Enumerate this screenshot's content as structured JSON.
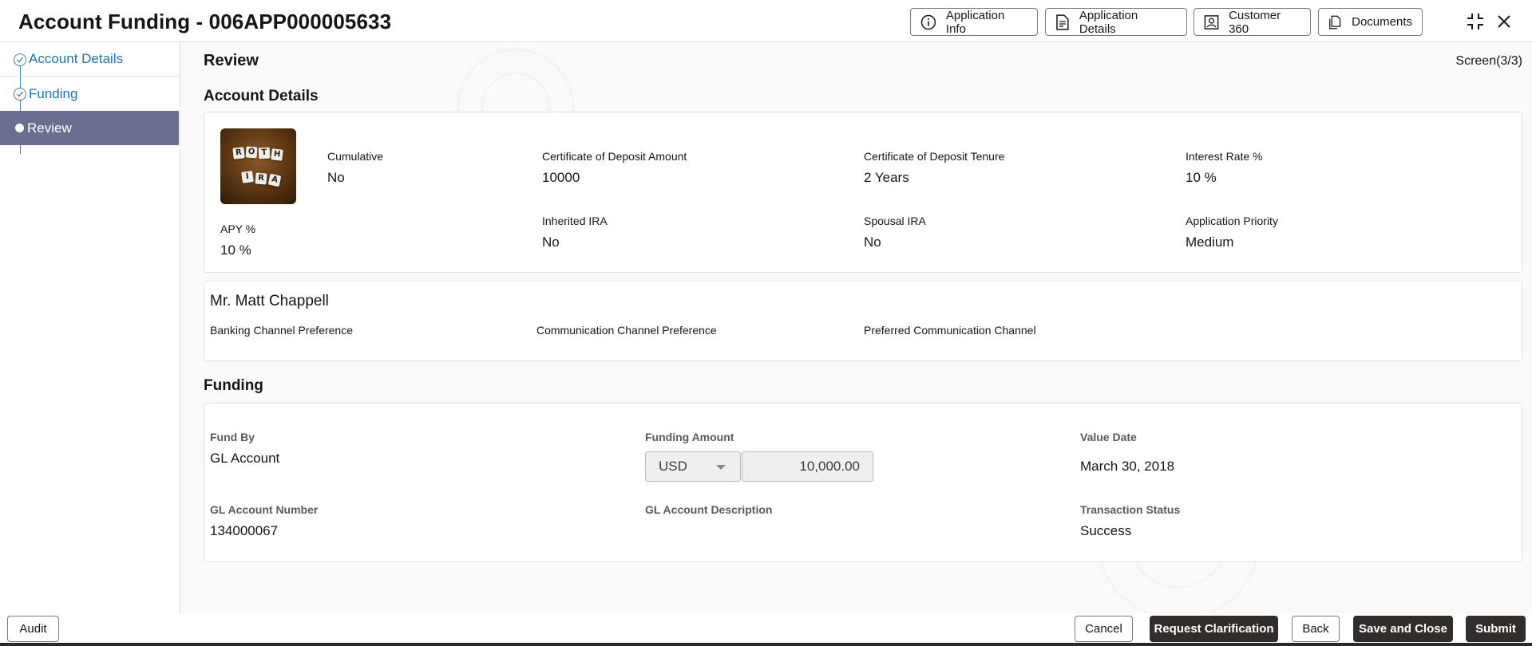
{
  "header": {
    "title": "Account Funding - 006APP000005633",
    "buttons": {
      "application_info": "Application Info",
      "application_details": "Application Details",
      "customer_360": "Customer 360",
      "documents": "Documents"
    }
  },
  "sidebar": {
    "items": [
      {
        "label": "Account Details",
        "state": "completed"
      },
      {
        "label": "Funding",
        "state": "completed"
      },
      {
        "label": "Review",
        "state": "active"
      }
    ]
  },
  "main": {
    "heading": "Review",
    "screen_indicator": "Screen(3/3)",
    "account_details": {
      "title": "Account Details",
      "image_tiles": [
        "R",
        "O",
        "T",
        "H",
        "I",
        "R",
        "A"
      ],
      "fields": {
        "cumulative": {
          "label": "Cumulative",
          "value": "No"
        },
        "cd_amount": {
          "label": "Certificate of Deposit Amount",
          "value": "10000"
        },
        "cd_tenure": {
          "label": "Certificate of Deposit Tenure",
          "value": "2 Years"
        },
        "interest_rate": {
          "label": "Interest Rate %",
          "value": "10 %"
        },
        "apy": {
          "label": "APY %",
          "value": "10 %"
        },
        "inherited_ira": {
          "label": "Inherited IRA",
          "value": "No"
        },
        "spousal_ira": {
          "label": "Spousal IRA",
          "value": "No"
        },
        "application_priority": {
          "label": "Application Priority",
          "value": "Medium"
        }
      }
    },
    "customer": {
      "name": "Mr. Matt Chappell",
      "banking_channel_label": "Banking Channel Preference",
      "communication_channel_label": "Communication Channel Preference",
      "preferred_channel_label": "Preferred Communication Channel"
    },
    "funding": {
      "title": "Funding",
      "fund_by": {
        "label": "Fund By",
        "value": "GL Account"
      },
      "funding_amount": {
        "label": "Funding Amount",
        "currency": "USD",
        "amount": "10,000.00"
      },
      "value_date": {
        "label": "Value Date",
        "value": "March 30, 2018"
      },
      "gl_account_number": {
        "label": "GL Account Number",
        "value": "134000067"
      },
      "gl_account_description": {
        "label": "GL Account Description"
      },
      "transaction_status": {
        "label": "Transaction Status",
        "value": "Success"
      }
    }
  },
  "footer": {
    "audit": "Audit",
    "cancel": "Cancel",
    "request_clarification": "Request Clarification",
    "back": "Back",
    "save_and_close": "Save and Close",
    "submit": "Submit"
  },
  "colors": {
    "accent_link": "#2472a4",
    "nav_active_bg": "#6a6f8f",
    "primary_button": "#312d2a"
  }
}
